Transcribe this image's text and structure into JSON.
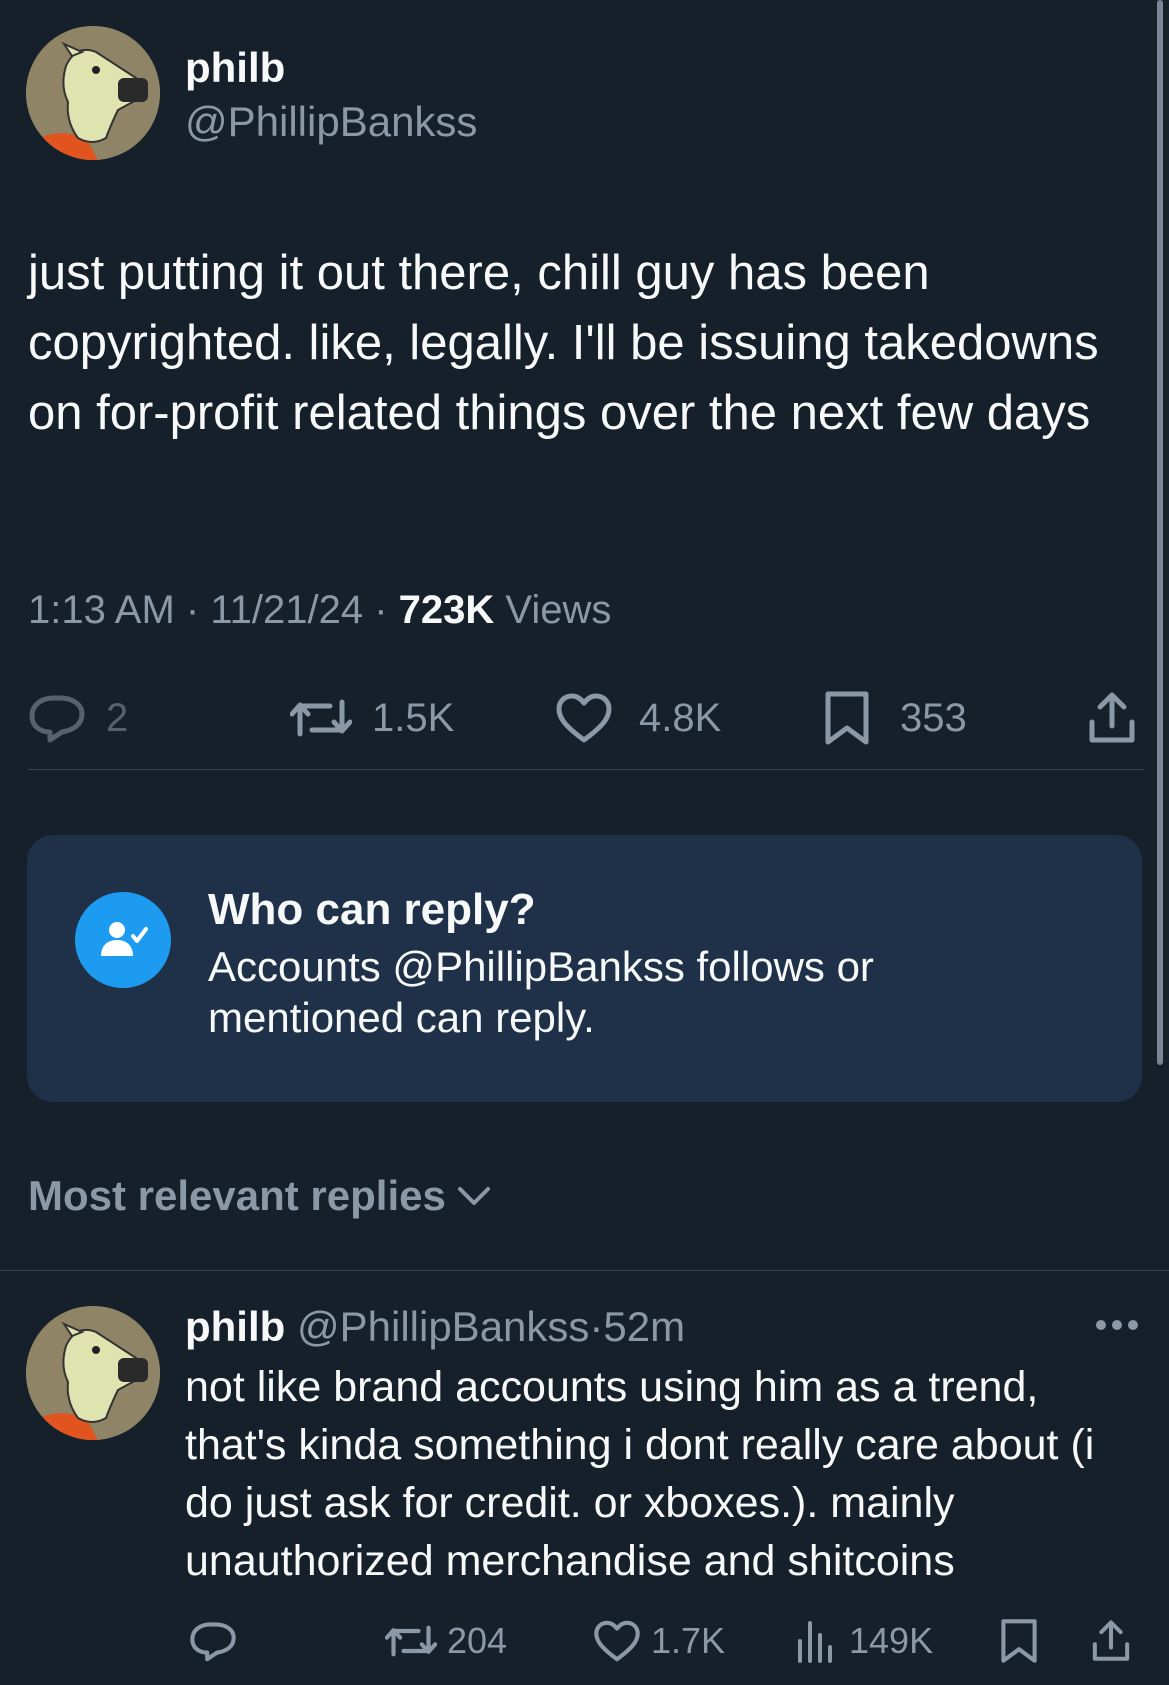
{
  "tweet": {
    "author_name": "philb",
    "author_handle": "@PhillipBankss",
    "text": "just putting it out there, chill guy has been copyrighted. like, legally. I'll be issuing takedowns on for-profit related things over the next few days",
    "time": "1:13 AM",
    "sep1": "·",
    "date": "11/21/24",
    "sep2": "·",
    "views_count": "723K",
    "views_label": "Views",
    "replies": "2",
    "reposts": "1.5K",
    "likes": "4.8K",
    "bookmarks": "353"
  },
  "reply_restriction": {
    "title": "Who can reply?",
    "body": "Accounts @PhillipBankss follows or mentioned can reply."
  },
  "sort": {
    "label": "Most relevant replies"
  },
  "reply": {
    "author_name": "philb",
    "author_handle": "@PhillipBankss",
    "separator": "·",
    "time": "52m",
    "text": "not like brand accounts using him as a trend, that's kinda something i dont really care about (i do just ask for credit. or xboxes.). mainly unauthorized merchandise and shitcoins",
    "reposts": "204",
    "likes": "1.7K",
    "views": "149K"
  },
  "colors": {
    "background": "#15202b",
    "text": "#f7f9f9",
    "muted": "#8b98a5",
    "accent": "#1d9bf0",
    "card": "#1e3148"
  }
}
